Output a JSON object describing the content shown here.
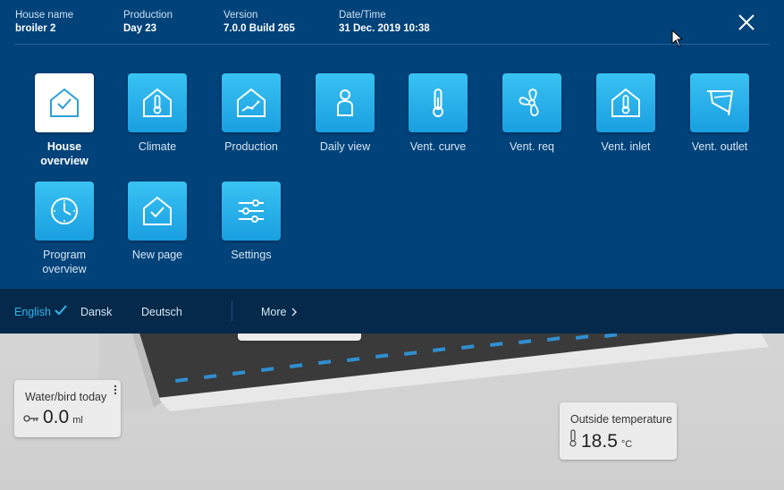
{
  "header": {
    "house_name_label": "House name",
    "house_name_value": "broiler 2",
    "production_label": "Production",
    "production_value": "Day 23",
    "version_label": "Version",
    "version_value": "7.0.0 Build 265",
    "datetime_label": "Date/Time",
    "datetime_value": "31 Dec. 2019 10:38"
  },
  "menu": {
    "items": [
      {
        "label_line1": "House",
        "label_line2": "overview",
        "icon": "house-check-icon",
        "active": true
      },
      {
        "label": "Climate",
        "icon": "house-thermometer-icon"
      },
      {
        "label": "Production",
        "icon": "house-chart-icon"
      },
      {
        "label": "Daily view",
        "icon": "person-icon"
      },
      {
        "label": "Vent. curve",
        "icon": "thermometer-icon"
      },
      {
        "label": "Vent. req",
        "icon": "fan-icon"
      },
      {
        "label": "Vent. inlet",
        "icon": "house-thermometer-icon"
      },
      {
        "label": "Vent. outlet",
        "icon": "outlet-damper-icon"
      },
      {
        "label_line1": "Program",
        "label_line2": "overview",
        "icon": "clock-icon"
      },
      {
        "label": "New page",
        "icon": "house-check-icon"
      },
      {
        "label": "Settings",
        "icon": "sliders-icon"
      }
    ]
  },
  "languages": {
    "items": [
      "English",
      "Dansk",
      "Deutsch"
    ],
    "selected": "English",
    "more_label": "More"
  },
  "background_cards": {
    "water": {
      "title": "Water/bird today",
      "value": "0.0",
      "unit": "ml",
      "icon": "key-icon"
    },
    "outside": {
      "title": "Outside temperature",
      "value": "18.5",
      "unit": "°C",
      "icon": "thermometer-icon"
    }
  },
  "colors": {
    "panel": "#00427a",
    "language_bar": "#04294a",
    "tile_accent": "#29b3ec",
    "selected_language": "#33b5ee"
  }
}
